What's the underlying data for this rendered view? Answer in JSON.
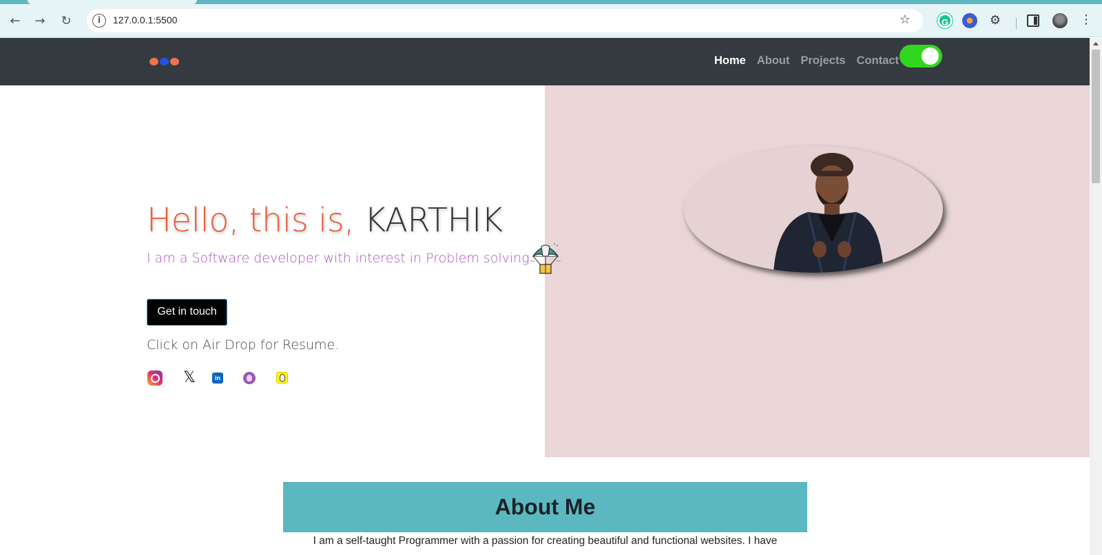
{
  "browser": {
    "url": "127.0.0.1:5500",
    "icons": {
      "back": "arrow-left-icon",
      "forward": "arrow-right-icon",
      "reload": "reload-icon",
      "site_info": "info-icon",
      "bookmark": "star-icon",
      "grammarly": "grammarly-icon",
      "extension": "extension-icon",
      "extensions_menu": "puzzle-icon",
      "side_panel": "side-panel-icon",
      "profile": "avatar",
      "menu": "kebab-menu-icon"
    },
    "grammarly_letter": "G"
  },
  "navbar": {
    "brand_dot_colors": [
      "#f0734f",
      "#1f56e3",
      "#f0734f"
    ],
    "links": [
      {
        "label": "Home",
        "active": true
      },
      {
        "label": "About",
        "active": false
      },
      {
        "label": "Projects",
        "active": false
      },
      {
        "label": "Contact",
        "active": false
      }
    ],
    "theme_toggle_on": true,
    "toggle_color": "#33d61f"
  },
  "hero": {
    "greeting": "Hello, this is,",
    "name": "KARTHIK",
    "subtitle": "I am a Software developer with interest in Problem solving",
    "cta_label": "Get in touch",
    "resume_hint": "Click on Air Drop for Resume.",
    "social_icons": [
      "instagram-icon",
      "x-icon",
      "linkedin-icon",
      "github-icon",
      "snapchat-icon"
    ],
    "linkedin_text": "in",
    "airdrop_icon": "parachute-icon",
    "colors": {
      "greeting": "#e9603c",
      "subtitle": "#b14fc6",
      "right_panel": "#ead6d6"
    }
  },
  "about": {
    "title": "About Me",
    "text": "I am a self-taught Programmer with a passion for creating beautiful and functional websites. I have",
    "header_color": "#5bb8c1"
  }
}
